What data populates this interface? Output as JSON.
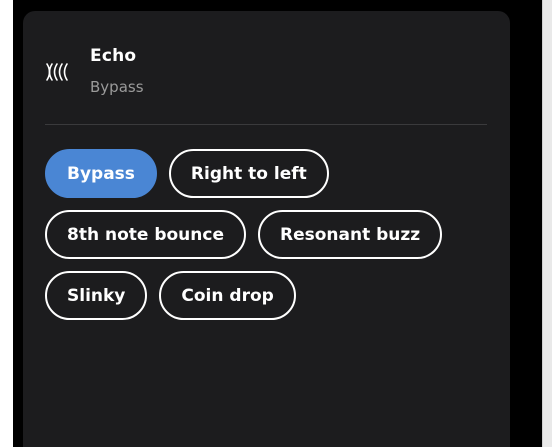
{
  "effect": {
    "icon": "echo-waves-icon",
    "title": "Echo",
    "current_preset": "Bypass"
  },
  "presets": [
    [
      {
        "label": "Bypass",
        "selected": true
      },
      {
        "label": "Right to left",
        "selected": false
      }
    ],
    [
      {
        "label": "8th note bounce",
        "selected": false
      },
      {
        "label": "Resonant buzz",
        "selected": false
      }
    ],
    [
      {
        "label": "Slinky",
        "selected": false
      },
      {
        "label": "Coin drop",
        "selected": false
      }
    ]
  ],
  "colors": {
    "panel_bg": "#1c1c1e",
    "selected_chip": "#4a86d4",
    "chip_border": "#ffffff",
    "subtitle": "#9a9a9a"
  }
}
